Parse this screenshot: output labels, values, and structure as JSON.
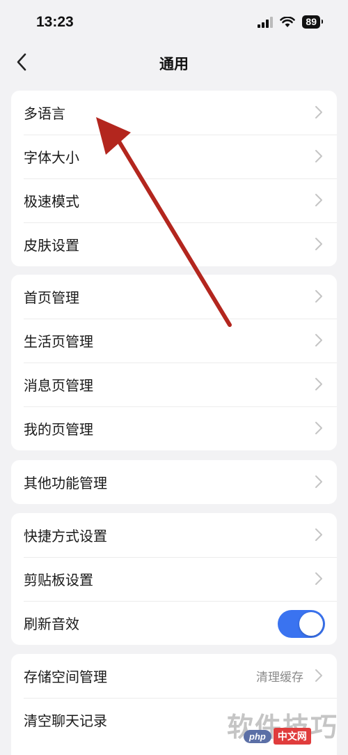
{
  "status_bar": {
    "time": "13:23",
    "battery": "89"
  },
  "nav": {
    "title": "通用"
  },
  "groups": [
    {
      "items": [
        {
          "label": "多语言"
        },
        {
          "label": "字体大小"
        },
        {
          "label": "极速模式"
        },
        {
          "label": "皮肤设置"
        }
      ]
    },
    {
      "items": [
        {
          "label": "首页管理"
        },
        {
          "label": "生活页管理"
        },
        {
          "label": "消息页管理"
        },
        {
          "label": "我的页管理"
        }
      ]
    },
    {
      "items": [
        {
          "label": "其他功能管理"
        }
      ]
    },
    {
      "items": [
        {
          "label": "快捷方式设置"
        },
        {
          "label": "剪贴板设置"
        },
        {
          "label": "刷新音效",
          "toggle_on": true
        }
      ]
    },
    {
      "items": [
        {
          "label": "存储空间管理",
          "value": "清理缓存"
        },
        {
          "label": "清空聊天记录"
        }
      ]
    }
  ],
  "annotation": {
    "arrow_color": "#b3261e"
  },
  "accent_color": "#3a73f0",
  "watermark": {
    "text": "软件技巧",
    "badge_logo": "php",
    "badge_text": "中文网"
  }
}
